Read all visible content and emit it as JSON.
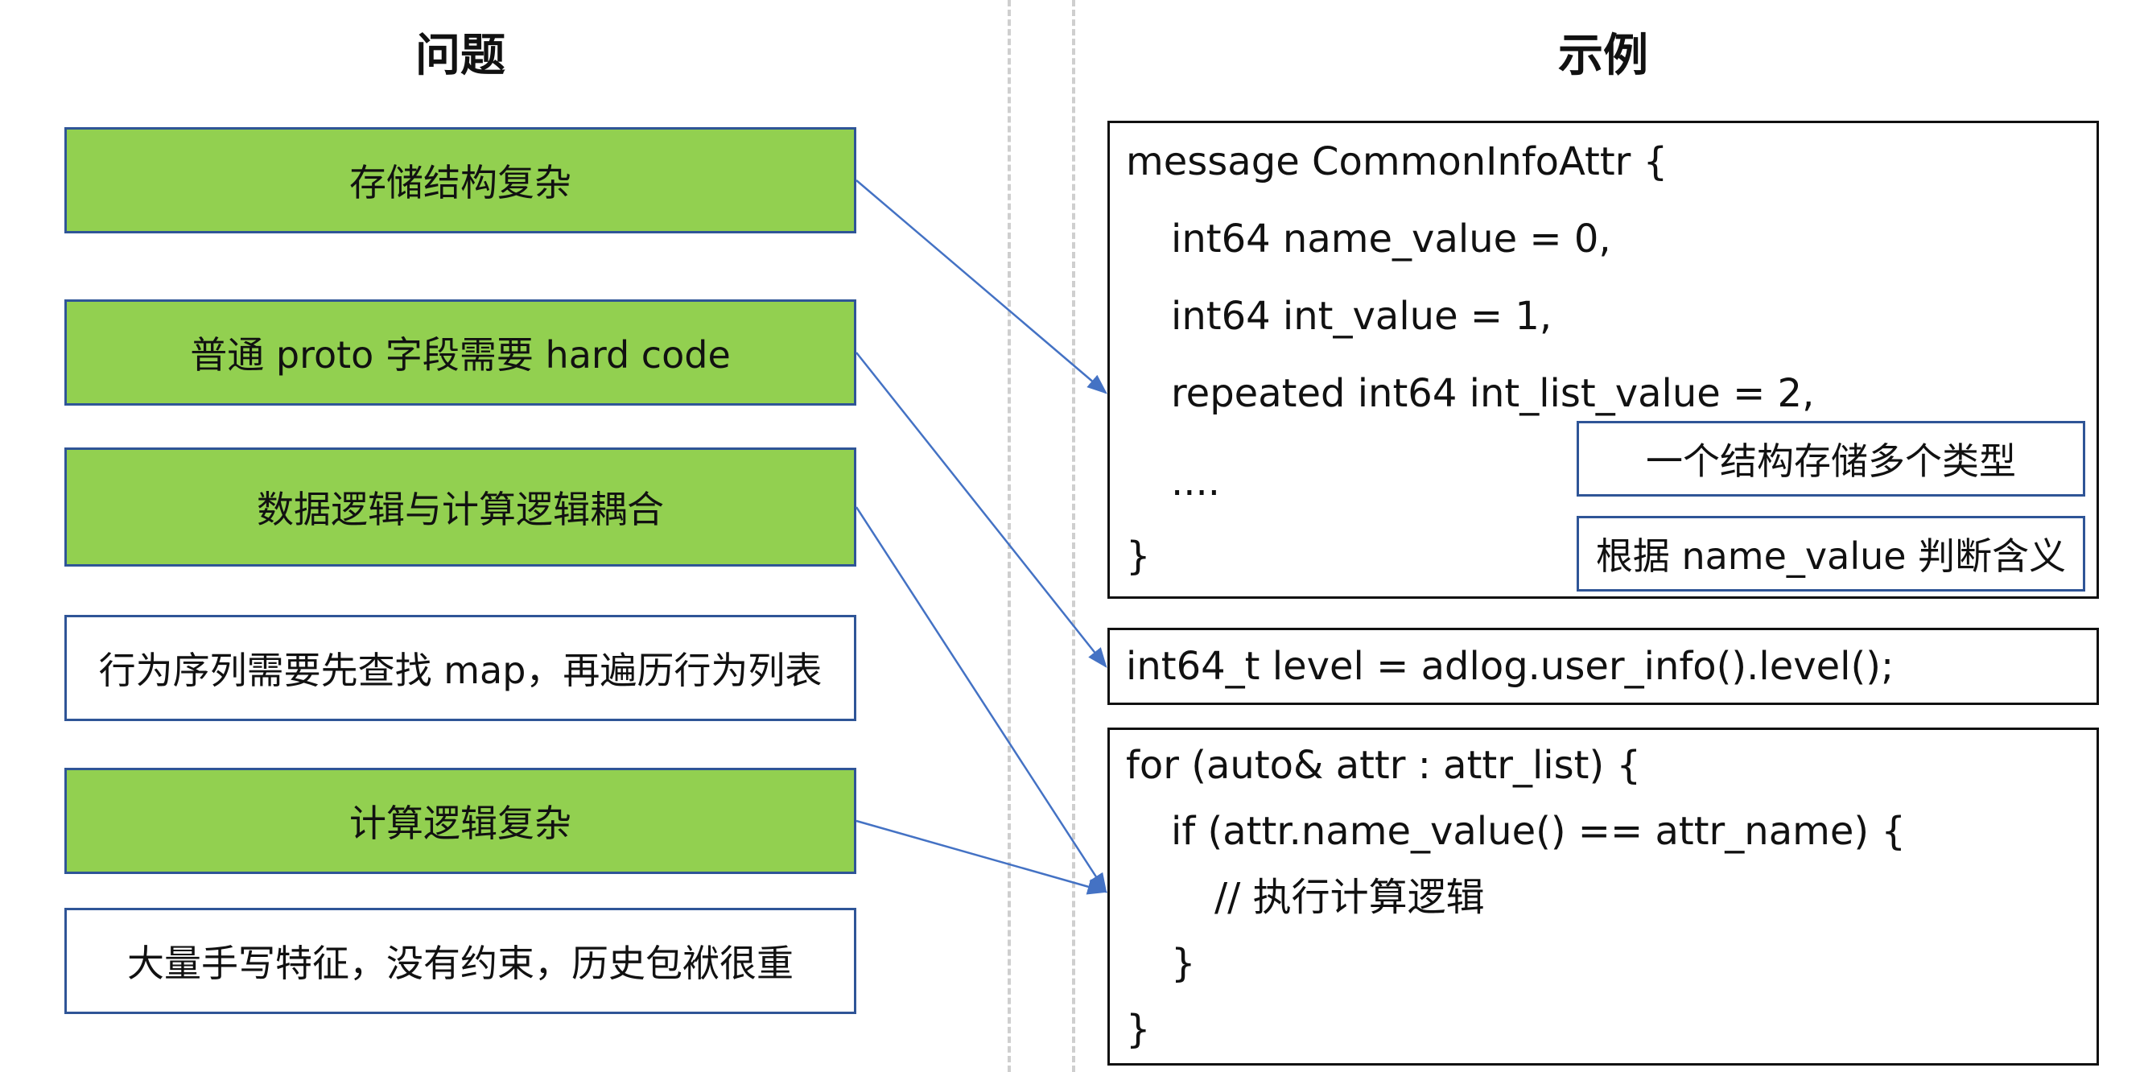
{
  "headings": {
    "left": "问题",
    "right": "示例"
  },
  "problems": [
    {
      "text": "存储结构复杂",
      "highlight": true
    },
    {
      "text": "普通 proto 字段需要 hard code",
      "highlight": true
    },
    {
      "text": "数据逻辑与计算逻辑耦合",
      "highlight": true
    },
    {
      "text": "行为序列需要先查找 map，再遍历行为列表",
      "highlight": false
    },
    {
      "text": "计算逻辑复杂",
      "highlight": true
    },
    {
      "text": "大量手写特征，没有约束，历史包袱很重",
      "highlight": false
    }
  ],
  "examples": {
    "message_def": [
      "message CommonInfoAttr {",
      "int64 name_value = 0,",
      "int64 int_value = 1,",
      "repeated int64 int_list_value = 2,",
      "....",
      "}"
    ],
    "message_notes": [
      "一个结构存储多个类型",
      "根据 name_value 判断含义"
    ],
    "access_line": "int64_t level = adlog.user_info().level();",
    "loop_code": [
      "for (auto& attr : attr_list) {",
      "if (attr.name_value() == attr_name) {",
      "// 执行计算逻辑",
      "}",
      "}"
    ]
  },
  "colors": {
    "highlight_fill": "#92d050",
    "box_border": "#2f5597",
    "arrow": "#4472c4",
    "divider": "#cfcfcf"
  }
}
